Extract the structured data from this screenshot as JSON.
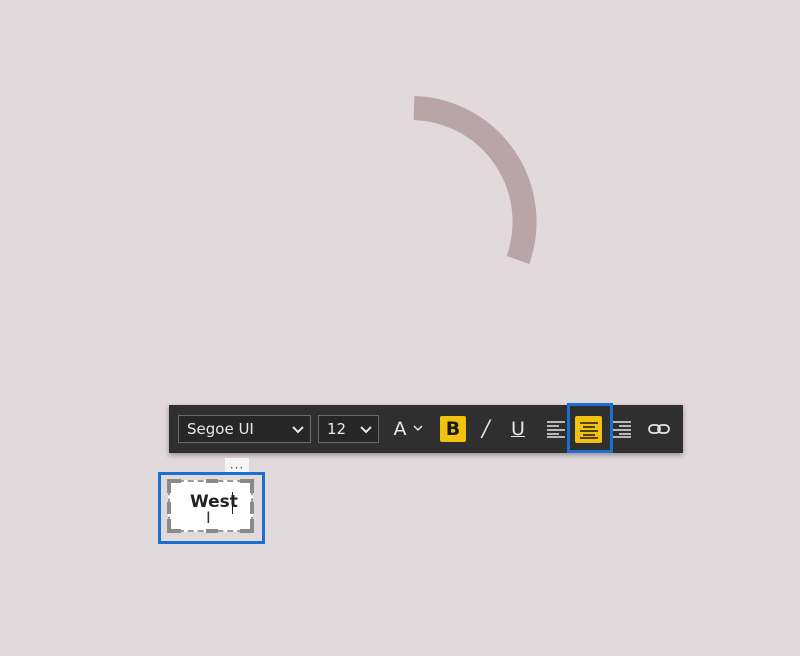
{
  "toolbar": {
    "font_family": "Segoe UI",
    "font_size": "12",
    "font_color_label": "A",
    "bold_label": "B",
    "italic_label": "/",
    "underline_label": "U",
    "bold_active": true,
    "align_center_active": true
  },
  "text_box": {
    "value": "West"
  },
  "more_options_label": "···",
  "colors": {
    "background": "#e2d9dc",
    "arc": "#b9a5a7",
    "toolbar_bg": "#2f2f2f",
    "active_accent": "#f2c20f",
    "highlight": "#1a6fd2"
  },
  "icons": [
    "chevron-down-icon",
    "align-left-icon",
    "align-center-icon",
    "align-right-icon",
    "link-icon",
    "text-cursor-icon"
  ]
}
